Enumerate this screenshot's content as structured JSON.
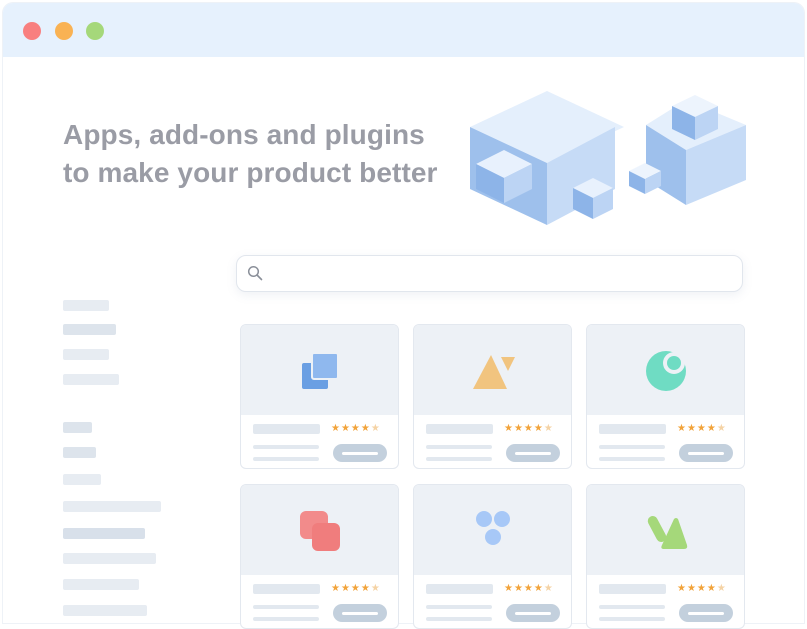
{
  "window": {
    "controls": [
      {
        "name": "close-dot",
        "color": "#f87f7f"
      },
      {
        "name": "minimize-dot",
        "color": "#f9b253"
      },
      {
        "name": "maximize-dot",
        "color": "#a5d87a"
      }
    ]
  },
  "hero": {
    "headline_line1": "Apps, add-ons and plugins",
    "headline_line2": "to make your product better"
  },
  "search": {
    "icon": "search-icon",
    "placeholder": ""
  },
  "cards": [
    {
      "icon": "overlapping-squares-icon",
      "icon_color": "#6a9fe3",
      "rating": 4,
      "max_rating": 5
    },
    {
      "icon": "triangles-icon",
      "icon_color": "#f1c47f",
      "rating": 4,
      "max_rating": 5
    },
    {
      "icon": "crescent-moon-icon",
      "icon_color": "#6fdcc3",
      "rating": 4,
      "max_rating": 5
    },
    {
      "icon": "rounded-squares-icon",
      "icon_color": "#f28b8b",
      "rating": 4,
      "max_rating": 5
    },
    {
      "icon": "three-circles-icon",
      "icon_color": "#a7c8f7",
      "rating": 4,
      "max_rating": 5
    },
    {
      "icon": "pill-triangle-icon",
      "icon_color": "#a5d87a",
      "rating": 4,
      "max_rating": 5
    }
  ],
  "colors": {
    "star": "#f2a33a",
    "placeholder": "#e2e8ef",
    "button": "#c3d0dd"
  }
}
